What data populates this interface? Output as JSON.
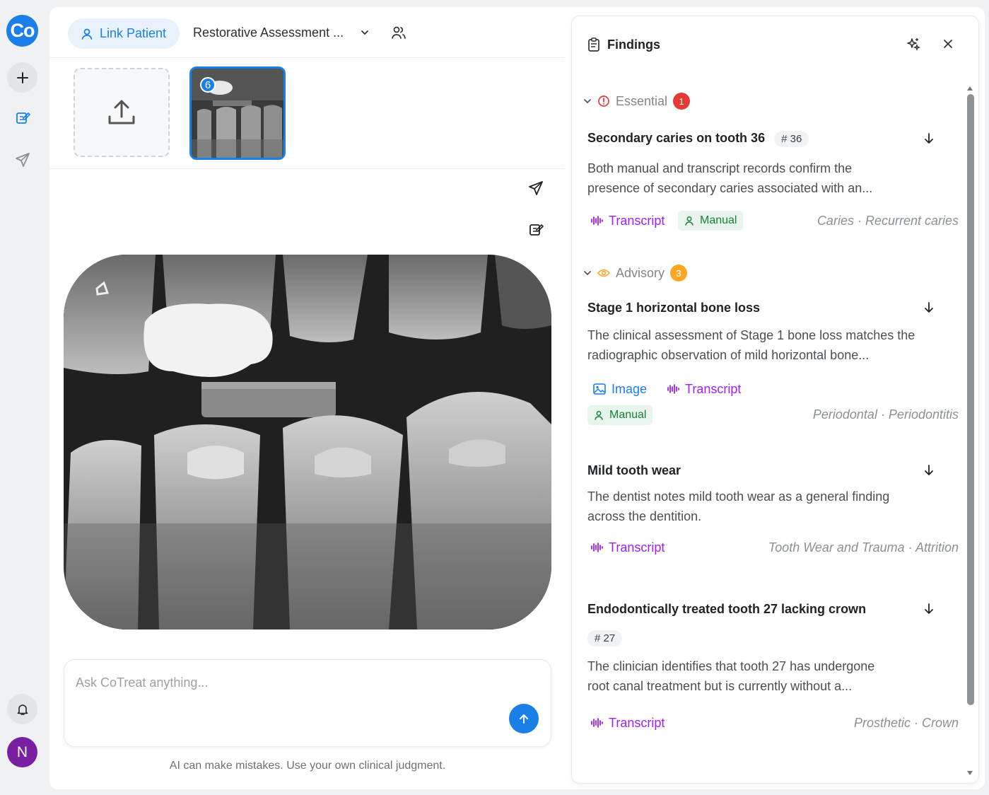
{
  "app": {
    "logo_text": "Co",
    "avatar_initial": "N"
  },
  "topbar": {
    "link_patient_label": "Link Patient",
    "assessment_title": "Restorative Assessment ..."
  },
  "thumbnails": [
    {
      "badge": "6",
      "selected": true
    }
  ],
  "chat": {
    "placeholder": "Ask CoTreat anything...",
    "disclaimer": "AI can make mistakes. Use your own clinical judgment."
  },
  "findings": {
    "title": "Findings",
    "sections": [
      {
        "name": "Essential",
        "count": "1",
        "color": "#e53935",
        "items": [
          {
            "title": "Secondary caries on tooth 36",
            "tooth": "# 36",
            "description_line1": "Both manual and transcript records confirm the",
            "description_line2": "presence of secondary caries associated with an...",
            "sources": [
              "Transcript",
              "Manual"
            ],
            "category": "Caries · Recurrent caries"
          }
        ]
      },
      {
        "name": "Advisory",
        "count": "3",
        "color": "#f9a825",
        "items": [
          {
            "title": "Stage 1 horizontal bone loss",
            "description_line1": "The clinical assessment of Stage 1 bone loss matches the",
            "description_line2": "radiographic observation of mild horizontal bone...",
            "sources": [
              "Image",
              "Transcript",
              "Manual"
            ],
            "category": "Periodontal · Periodontitis"
          },
          {
            "title": "Mild tooth wear",
            "description_line1": "The dentist notes mild tooth wear as a general finding",
            "description_line2": "across the dentition.",
            "sources": [
              "Transcript"
            ],
            "category": "Tooth Wear and Trauma · Attrition"
          },
          {
            "title": "Endodontically treated tooth 27 lacking crown",
            "tooth": "# 27",
            "description_line1": "The clinician identifies that tooth 27 has undergone",
            "description_line2": "root canal treatment but is currently without a...",
            "sources": [
              "Transcript"
            ],
            "category": "Prosthetic · Crown"
          }
        ]
      }
    ]
  },
  "colors": {
    "accent": "#1a7fe6",
    "transcript": "#a020f0",
    "manual": "#188038"
  }
}
